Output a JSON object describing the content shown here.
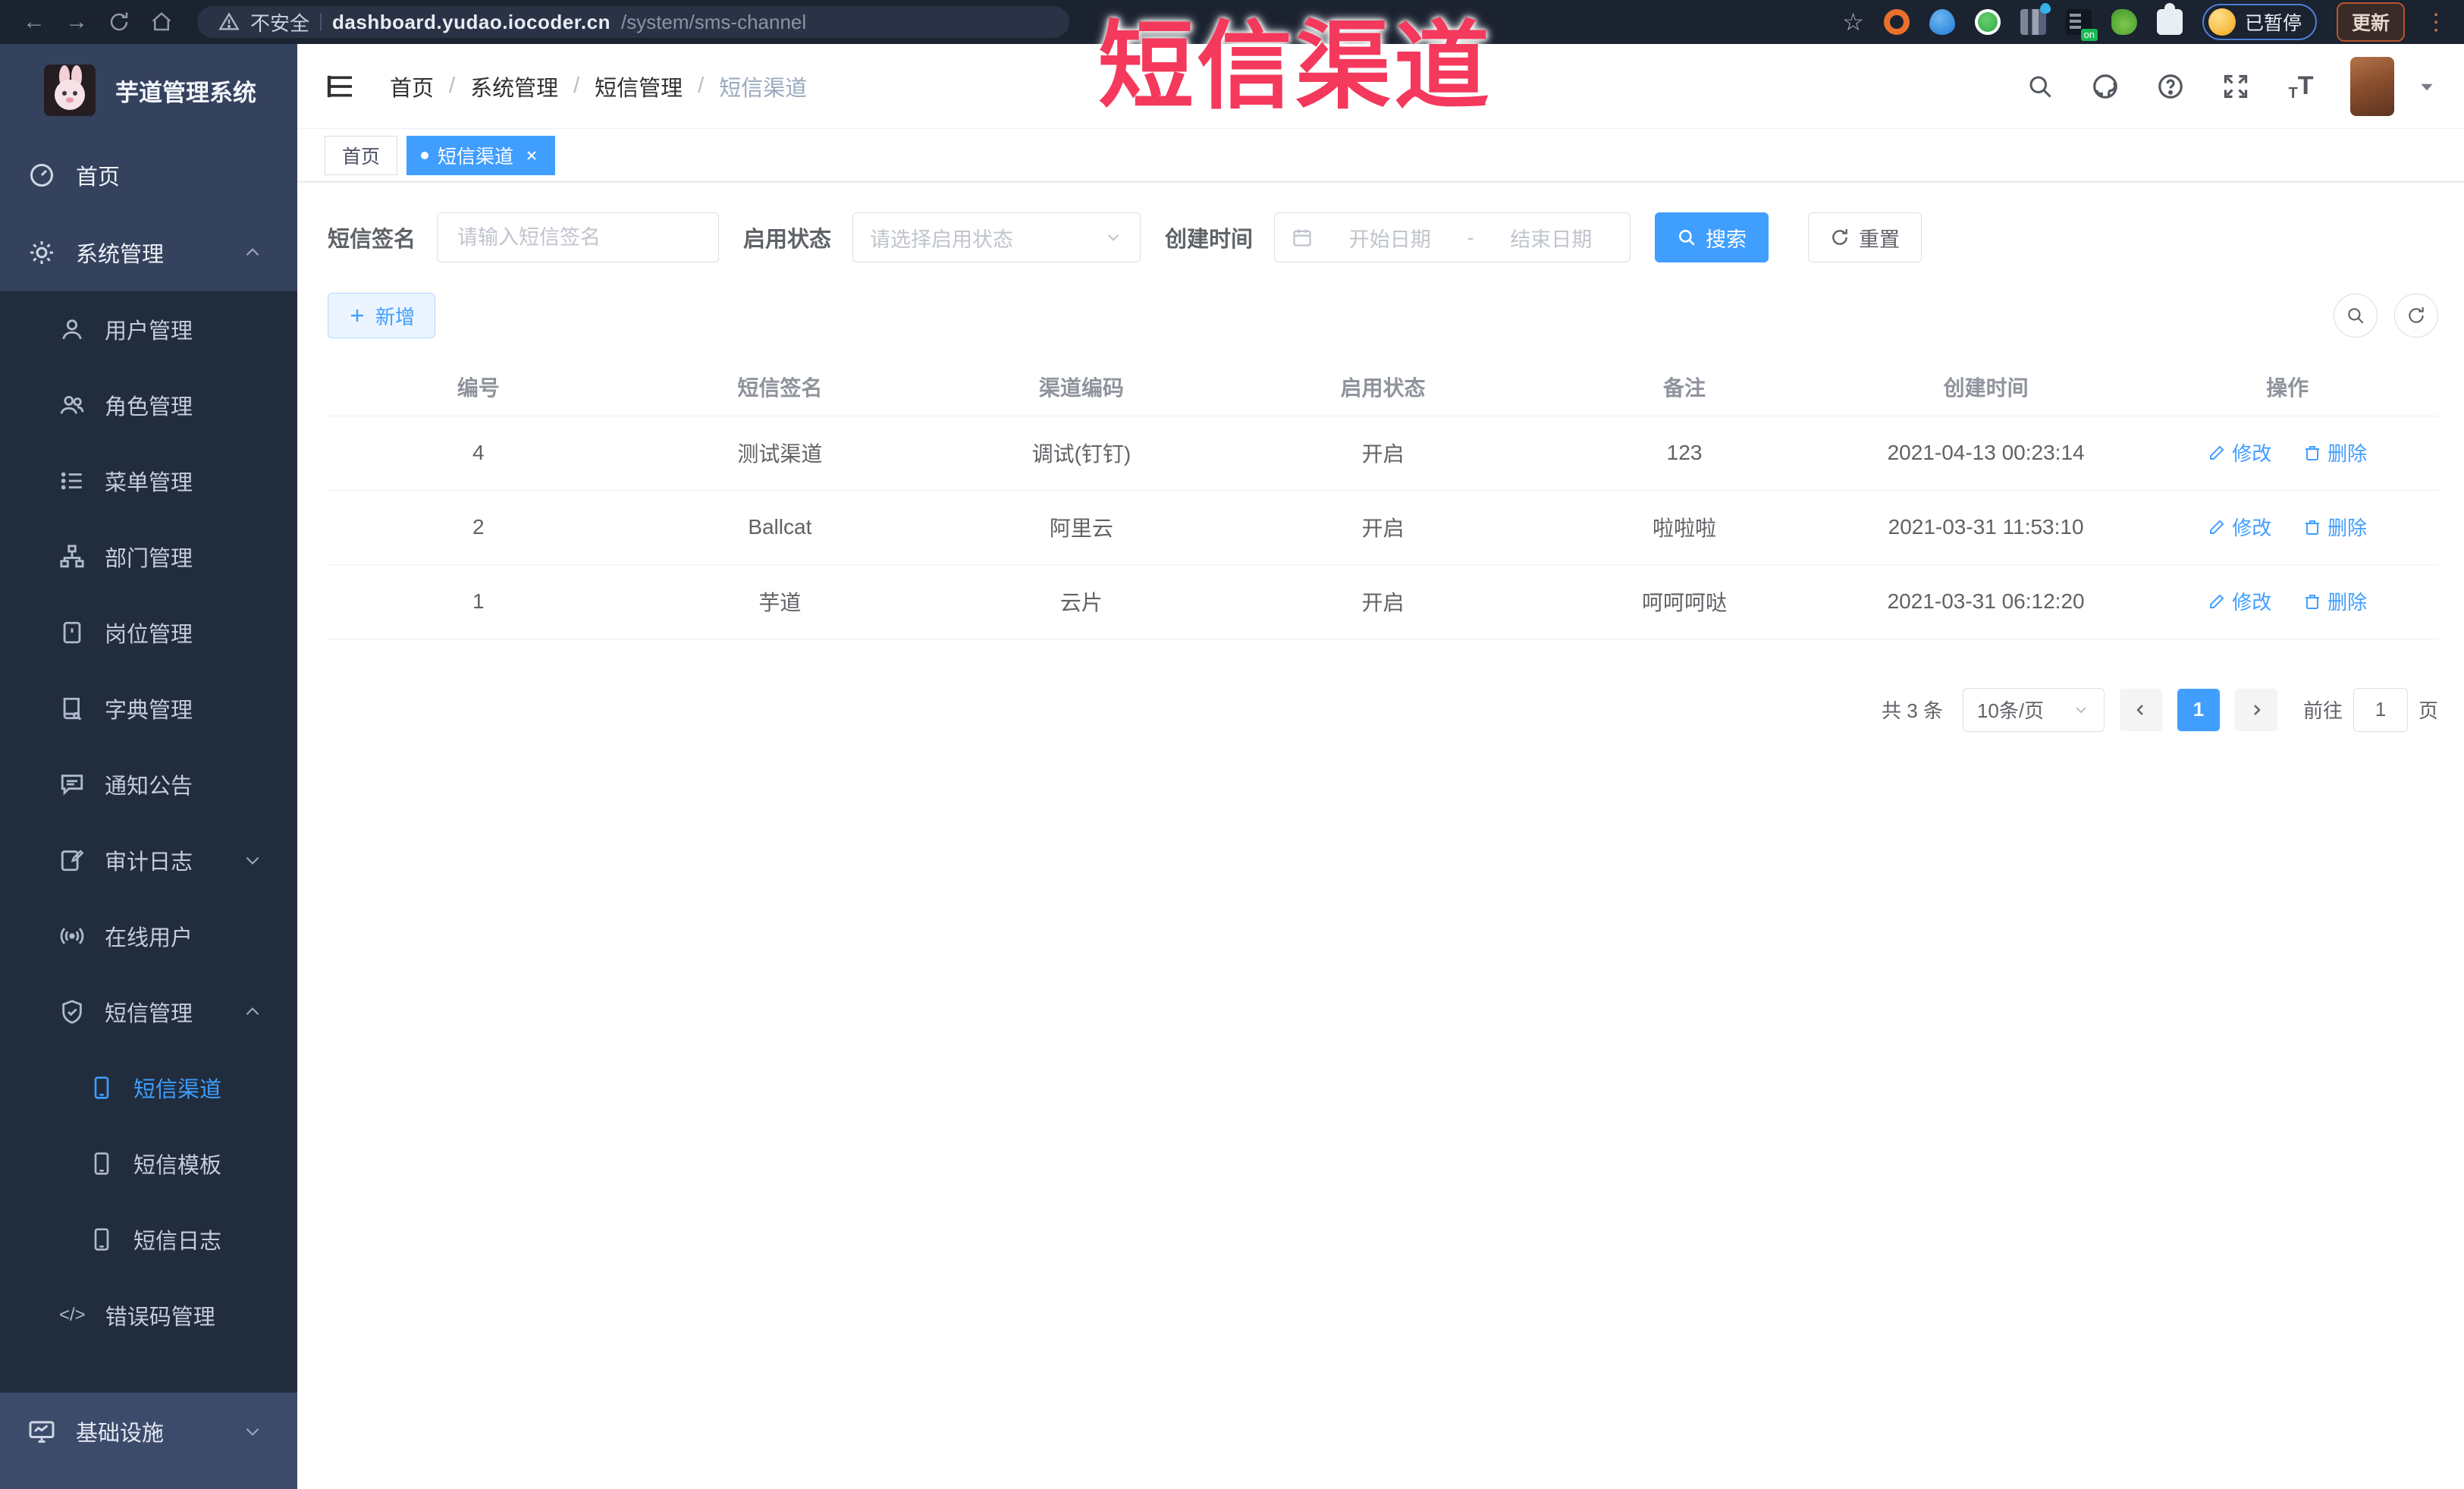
{
  "colors": {
    "accent": "#409eff",
    "watermark_red": "#f4395c",
    "sidebar_bg": "#35425e",
    "submenu_bg": "#212c3d"
  },
  "browser": {
    "security_label": "不安全",
    "url_host": "dashboard.yudao.iocoder.cn",
    "url_path": "/system/sms-channel",
    "extension_badge": "on",
    "paused_label": "已暂停",
    "update_label": "更新"
  },
  "watermark": "短信渠道",
  "sidebar": {
    "title": "芋道管理系统",
    "items": [
      {
        "label": "首页"
      },
      {
        "label": "系统管理"
      },
      {
        "label": "用户管理"
      },
      {
        "label": "角色管理"
      },
      {
        "label": "菜单管理"
      },
      {
        "label": "部门管理"
      },
      {
        "label": "岗位管理"
      },
      {
        "label": "字典管理"
      },
      {
        "label": "通知公告"
      },
      {
        "label": "审计日志"
      },
      {
        "label": "在线用户"
      },
      {
        "label": "短信管理"
      },
      {
        "label": "短信渠道"
      },
      {
        "label": "短信模板"
      },
      {
        "label": "短信日志"
      },
      {
        "label": "错误码管理"
      },
      {
        "label": "基础设施"
      }
    ]
  },
  "breadcrumb": {
    "separator": "/",
    "items": [
      "首页",
      "系统管理",
      "短信管理",
      "短信渠道"
    ]
  },
  "tabs": [
    {
      "label": "首页"
    },
    {
      "label": "短信渠道"
    }
  ],
  "filters": {
    "signature_label": "短信签名",
    "signature_placeholder": "请输入短信签名",
    "status_label": "启用状态",
    "status_placeholder": "请选择启用状态",
    "created_label": "创建时间",
    "date_start_placeholder": "开始日期",
    "date_separator": "-",
    "date_end_placeholder": "结束日期",
    "search_label": "搜索",
    "reset_label": "重置"
  },
  "toolbar": {
    "add_label": "新增"
  },
  "table": {
    "columns": [
      "编号",
      "短信签名",
      "渠道编码",
      "启用状态",
      "备注",
      "创建时间",
      "操作"
    ],
    "edit_label": "修改",
    "delete_label": "删除",
    "rows": [
      {
        "id": "4",
        "signature": "测试渠道",
        "code": "调试(钉钉)",
        "status": "开启",
        "remark": "123",
        "created": "2021-04-13 00:23:14"
      },
      {
        "id": "2",
        "signature": "Ballcat",
        "code": "阿里云",
        "status": "开启",
        "remark": "啦啦啦",
        "created": "2021-03-31 11:53:10"
      },
      {
        "id": "1",
        "signature": "芋道",
        "code": "云片",
        "status": "开启",
        "remark": "呵呵呵哒",
        "created": "2021-03-31 06:12:20"
      }
    ]
  },
  "pagination": {
    "total_text": "共 3 条",
    "page_size": "10条/页",
    "current_page": "1",
    "goto_label": "前往",
    "goto_value": "1",
    "page_unit": "页"
  },
  "icons": {
    "help_glyph": "?",
    "font_size_glyph": "T",
    "code_glyph": "</>",
    "star_glyph": "☆",
    "back_glyph": "←",
    "forward_glyph": "→",
    "kebab_glyph": "⋮"
  }
}
